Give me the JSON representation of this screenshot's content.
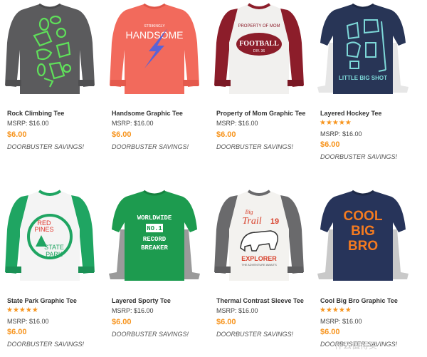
{
  "colors": {
    "accent": "#f7941d",
    "text": "#333333"
  },
  "products": [
    {
      "name": "Rock Climbing Tee",
      "stars": "",
      "msrp": "MSRP: $16.00",
      "price": "$6.00",
      "promo": "DOORBUSTER SAVINGS!"
    },
    {
      "name": "Handsome Graphic Tee",
      "stars": "",
      "msrp": "MSRP: $16.00",
      "price": "$6.00",
      "promo": "DOORBUSTER SAVINGS!"
    },
    {
      "name": "Property of Mom Graphic Tee",
      "stars": "",
      "msrp": "MSRP: $16.00",
      "price": "$6.00",
      "promo": "DOORBUSTER SAVINGS!"
    },
    {
      "name": "Layered Hockey Tee",
      "stars": "★★★★★",
      "msrp": "MSRP: $16.00",
      "price": "$6.00",
      "promo": "DOORBUSTER SAVINGS!"
    },
    {
      "name": "State Park Graphic Tee",
      "stars": "★★★★★",
      "msrp": "MSRP: $16.00",
      "price": "$6.00",
      "promo": "DOORBUSTER SAVINGS!"
    },
    {
      "name": "Layered Sporty Tee",
      "stars": "",
      "msrp": "MSRP: $16.00",
      "price": "$6.00",
      "promo": "DOORBUSTER SAVINGS!"
    },
    {
      "name": "Thermal Contrast Sleeve Tee",
      "stars": "",
      "msrp": "MSRP: $16.00",
      "price": "$6.00",
      "promo": "DOORBUSTER SAVINGS!"
    },
    {
      "name": "Cool Big Bro Graphic Tee",
      "stars": "★★★★★",
      "msrp": "MSRP: $16.00",
      "price": "$6.00",
      "promo": "DOORBUSTER SAVINGS!"
    }
  ],
  "shirt_graphics": {
    "handsome": [
      "STRIKINGLY",
      "HANDSOME"
    ],
    "football": [
      "PROPERTY OF MOM",
      "FOOTBALL",
      "DIV. 36"
    ],
    "hockey": [
      "LITTLE BIG SHOT"
    ],
    "park": [
      "RED",
      "PINES",
      "STATE",
      "PARK"
    ],
    "sporty": [
      "WORLDWIDE",
      "NO.1",
      "RECORD",
      "BREAKER"
    ],
    "trail": [
      "Big",
      "Trail",
      "19",
      "EXPLORER",
      "THE ADVENTURE AWAITS"
    ],
    "bro": [
      "COOL",
      "BIG",
      "BRO"
    ]
  },
  "watermark": "什么值得买"
}
